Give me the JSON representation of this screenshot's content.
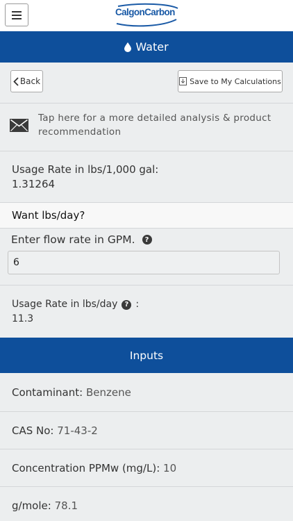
{
  "header": {
    "logo_text": "CalgonCarbon",
    "menu_icon": "hamburger-icon"
  },
  "titlebar": {
    "icon": "water-drop-icon",
    "title": "Water"
  },
  "toolbar": {
    "back_label": "Back",
    "save_label": "Save to My Calculations"
  },
  "analysis": {
    "icon": "envelope-icon",
    "text": "Tap here for a more detailed analysis & product recommendation"
  },
  "usage": {
    "label": "Usage Rate in lbs/1,000 gal:",
    "value": "1.31264"
  },
  "want": {
    "label": "Want lbs/day?"
  },
  "flow": {
    "label": "Enter flow rate in GPM.",
    "value": "6"
  },
  "daily": {
    "label": "Usage Rate in lbs/day",
    "colon": ":",
    "value": "11.3"
  },
  "inputs": {
    "title": "Inputs",
    "rows": [
      {
        "label": "Contaminant:",
        "value": "Benzene"
      },
      {
        "label": "CAS No:",
        "value": "71-43-2"
      },
      {
        "label": "Concentration PPMw (mg/L):",
        "value": "10"
      },
      {
        "label": "g/mole:",
        "value": "78.1"
      }
    ]
  }
}
